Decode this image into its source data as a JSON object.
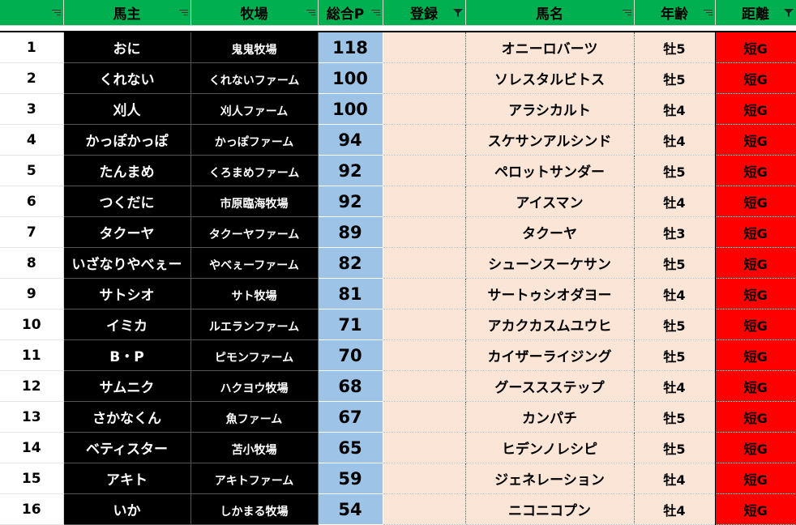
{
  "headers": [
    "",
    "馬主",
    "牧場",
    "総合P",
    "登録",
    "馬名",
    "年齢",
    "距離"
  ],
  "rows": [
    {
      "no": "1",
      "owner": "おに",
      "farm": "鬼鬼牧場",
      "points": "118",
      "reg": "",
      "horse": "オニーロバーツ",
      "age": "牡5",
      "dist": "短G"
    },
    {
      "no": "2",
      "owner": "くれない",
      "farm": "くれないファーム",
      "points": "100",
      "reg": "",
      "horse": "ソレスタルビトス",
      "age": "牡5",
      "dist": "短G"
    },
    {
      "no": "3",
      "owner": "刈人",
      "farm": "刈人ファーム",
      "points": "100",
      "reg": "",
      "horse": "アラシカルト",
      "age": "牡4",
      "dist": "短G"
    },
    {
      "no": "4",
      "owner": "かっぽかっぽ",
      "farm": "かっぽファーム",
      "points": "94",
      "reg": "",
      "horse": "スケサンアルシンド",
      "age": "牡4",
      "dist": "短G"
    },
    {
      "no": "5",
      "owner": "たんまめ",
      "farm": "くろまめファーム",
      "points": "92",
      "reg": "",
      "horse": "ペロットサンダー",
      "age": "牡5",
      "dist": "短G"
    },
    {
      "no": "6",
      "owner": "つくだに",
      "farm": "市原臨海牧場",
      "points": "92",
      "reg": "",
      "horse": "アイスマン",
      "age": "牡4",
      "dist": "短G"
    },
    {
      "no": "7",
      "owner": "タクーヤ",
      "farm": "タクーヤファーム",
      "points": "89",
      "reg": "",
      "horse": "タクーヤ",
      "age": "牡3",
      "dist": "短G"
    },
    {
      "no": "8",
      "owner": "いざなりやべぇー",
      "farm": "やべぇーファーム",
      "points": "82",
      "reg": "",
      "horse": "シューンスーケサン",
      "age": "牡5",
      "dist": "短G"
    },
    {
      "no": "9",
      "owner": "サトシオ",
      "farm": "サト牧場",
      "points": "81",
      "reg": "",
      "horse": "サートゥシオダヨー",
      "age": "牡4",
      "dist": "短G"
    },
    {
      "no": "10",
      "owner": "イミカ",
      "farm": "ルエランファーム",
      "points": "71",
      "reg": "",
      "horse": "アカクカスムユウヒ",
      "age": "牡5",
      "dist": "短G"
    },
    {
      "no": "11",
      "owner": "B・P",
      "farm": "ピモンファーム",
      "points": "70",
      "reg": "",
      "horse": "カイザーライジング",
      "age": "牡5",
      "dist": "短G"
    },
    {
      "no": "12",
      "owner": "サムニク",
      "farm": "ハクヨウ牧場",
      "points": "68",
      "reg": "",
      "horse": "グーススステップ",
      "age": "牡4",
      "dist": "短G"
    },
    {
      "no": "13",
      "owner": "さかなくん",
      "farm": "魚ファーム",
      "points": "67",
      "reg": "",
      "horse": "カンパチ",
      "age": "牡5",
      "dist": "短G"
    },
    {
      "no": "14",
      "owner": "ベティスター",
      "farm": "苫小牧場",
      "points": "65",
      "reg": "",
      "horse": "ヒデンノレシピ",
      "age": "牡5",
      "dist": "短G"
    },
    {
      "no": "15",
      "owner": "アキト",
      "farm": "アキトファーム",
      "points": "59",
      "reg": "",
      "horse": "ジェネレーション",
      "age": "牡4",
      "dist": "短G"
    },
    {
      "no": "16",
      "owner": "いか",
      "farm": "しかまる牧場",
      "points": "54",
      "reg": "",
      "horse": "ニコニコプン",
      "age": "牡4",
      "dist": "短G"
    }
  ],
  "colors": {
    "header": "#00b050",
    "owner_bg": "#000000",
    "points_bg": "#9dc3e6",
    "horse_bg": "#fbe5d6",
    "dist_bg": "#ff0000"
  }
}
